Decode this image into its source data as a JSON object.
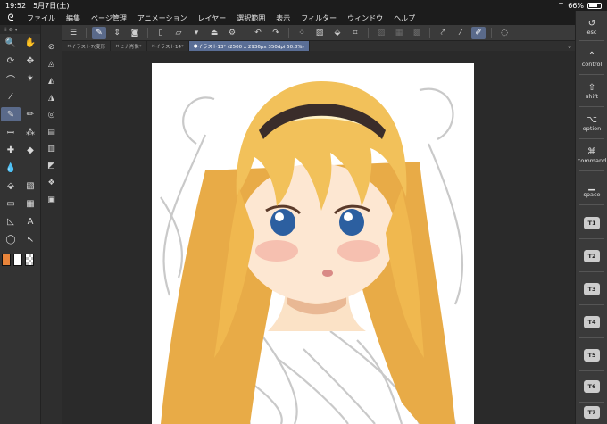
{
  "status": {
    "time": "19:52",
    "date": "5月7日(土)",
    "battery": "66%"
  },
  "menu": {
    "items": [
      "ファイル",
      "編集",
      "ページ管理",
      "アニメーション",
      "レイヤー",
      "選択範囲",
      "表示",
      "フィルター",
      "ウィンドウ",
      "ヘルプ"
    ]
  },
  "tabs": [
    {
      "label": "イラスト7(変形"
    },
    {
      "label": "ヒナ肖像*"
    },
    {
      "label": "イラスト14*"
    },
    {
      "label": "イラスト13* (2500 x 2936px 350dpi 50.8%)"
    }
  ],
  "shortcuts": {
    "esc": "esc",
    "control": "control",
    "shift": "shift",
    "option": "option",
    "command": "command",
    "space": "space",
    "t_keys": [
      "T1",
      "T2",
      "T3",
      "T4",
      "T5",
      "T6",
      "T7"
    ]
  },
  "colors": {
    "main": "#e8843a",
    "sub": "#ffffff",
    "accent": "#5a6e96"
  }
}
